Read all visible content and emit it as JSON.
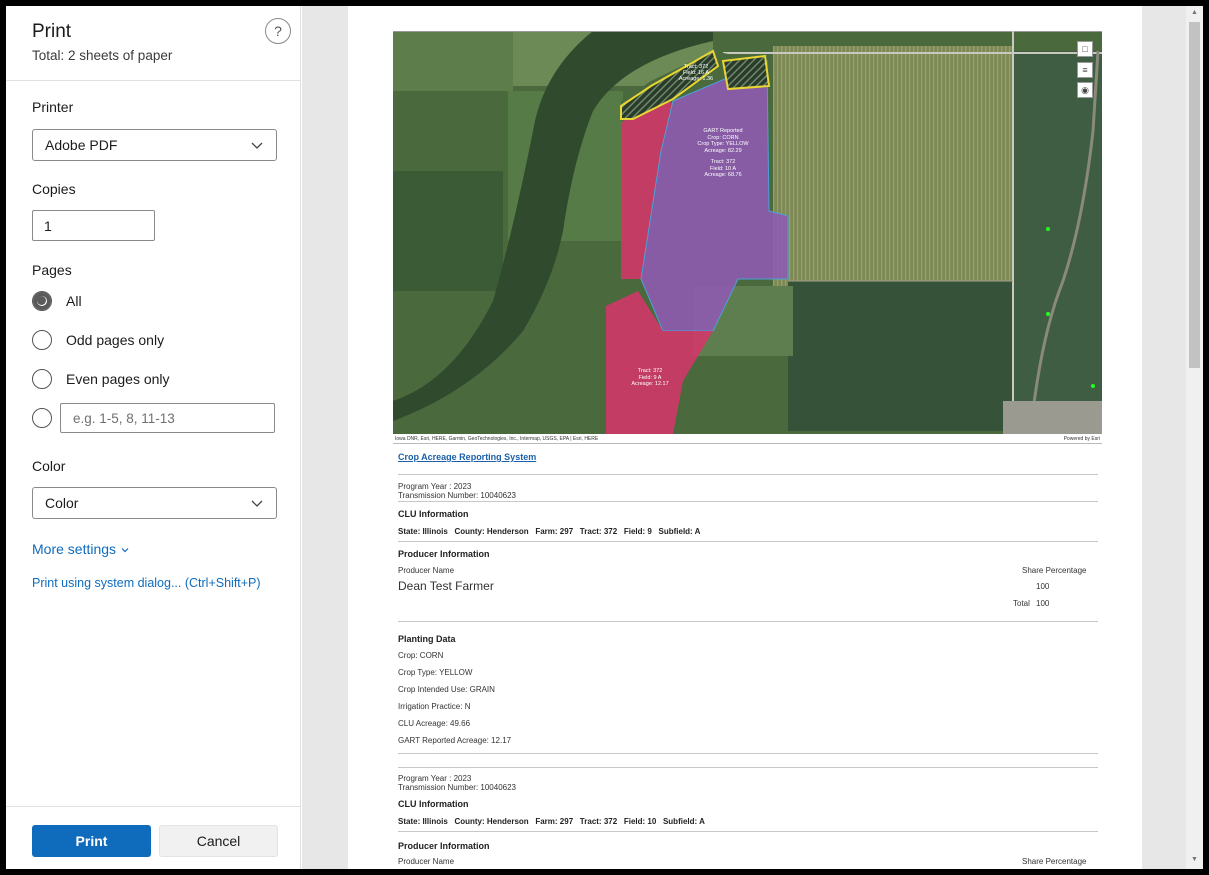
{
  "panel": {
    "title": "Print",
    "subtitle": "Total: 2 sheets of paper",
    "help": "?",
    "printer_label": "Printer",
    "printer_value": "Adobe PDF",
    "copies_label": "Copies",
    "copies_value": "1",
    "pages_label": "Pages",
    "pages_options": [
      "All",
      "Odd pages only",
      "Even pages only"
    ],
    "pages_range_placeholder": "e.g. 1-5, 8, 11-13",
    "color_label": "Color",
    "color_value": "Color",
    "more_settings": "More settings",
    "system_dialog": "Print using system dialog... (Ctrl+Shift+P)",
    "print_button": "Print",
    "cancel_button": "Cancel"
  },
  "map": {
    "labels": {
      "top": [
        "Tract: 372",
        "Field: 16 A",
        "Acreage: 1.36"
      ],
      "center_a": [
        "GART Reported",
        "Crop: CORN",
        "Crop Type: YELLOW",
        "Acreage: 82.29"
      ],
      "center_b": [
        "Tract: 372",
        "Field: 10 A",
        "Acreage: 68.76"
      ],
      "bottom": [
        "Tract: 372",
        "Field: 9 A",
        "Acreage: 12.17"
      ]
    },
    "attribution": "Iowa DNR, Esri, HERE, Garmin, GeoTechnologies, Inc., Intermap, USGS, EPA | Esri, HERE",
    "powered_by": "Powered by Esri"
  },
  "report": {
    "title": "Crop Acreage Reporting System",
    "records": [
      {
        "program_year": "Program Year : 2023",
        "transmission": "Transmission Number: 10040623",
        "clu_heading": "CLU Information",
        "clu_line": "State: Illinois   County: Henderson   Farm: 297   Tract: 372   Field: 9   Subfield: A"
      },
      {
        "program_year": "Program Year : 2023",
        "transmission": "Transmission Number: 10040623",
        "clu_heading": "CLU Information",
        "clu_line": "State: Illinois   County: Henderson   Farm: 297   Tract: 372   Field: 10   Subfield: A"
      }
    ],
    "producer_heading": "Producer Information",
    "producer_name_label": "Producer Name",
    "share_label": "Share Percentage",
    "producer_name": "Dean Test Farmer",
    "share_value": "100",
    "total_label": "Total",
    "total_value": "100",
    "planting_heading": "Planting Data",
    "planting_lines": [
      "Crop: CORN",
      "Crop Type: YELLOW",
      "Crop Intended Use: GRAIN",
      "Irrigation Practice: N",
      "CLU Acreage: 49.66",
      "GART Reported Acreage: 12.17"
    ]
  }
}
